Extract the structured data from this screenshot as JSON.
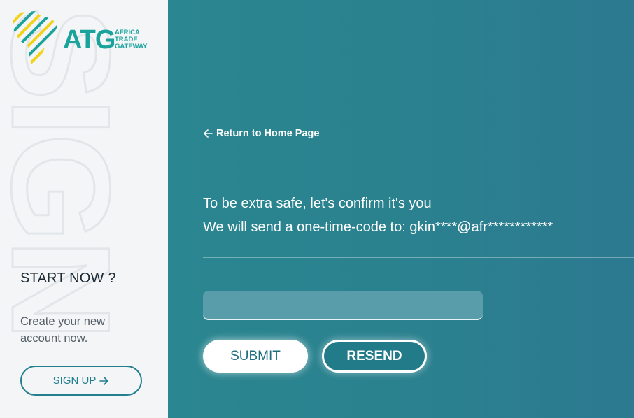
{
  "sidebar": {
    "logo": {
      "abbr": "ATG",
      "name_lines": [
        "AFRICA",
        "TRADE",
        "GATEWAY"
      ],
      "icon": "africa-map-logo-icon"
    },
    "watermark_text": "SIGN",
    "start_title": "START NOW ?",
    "start_desc": "Create your new account now.",
    "signup_label": "SIGN UP",
    "signup_icon": "arrow-right-icon"
  },
  "main": {
    "back_label": "Return to Home Page",
    "back_icon": "arrow-left-icon",
    "line1": "To be extra safe, let's confirm it's you",
    "line2": "We will send a one-time-code to: gkin****@afr************",
    "code_input": {
      "value": "",
      "placeholder": ""
    },
    "submit_label": "SUBMIT",
    "resend_label": "RESEND"
  },
  "colors": {
    "accent": "#1aa39c",
    "logo_yellow": "#f2d31b",
    "main_bg": "#2b828f",
    "sidebar_bg": "#f3f5f7",
    "button_teal": "#217f8e"
  }
}
